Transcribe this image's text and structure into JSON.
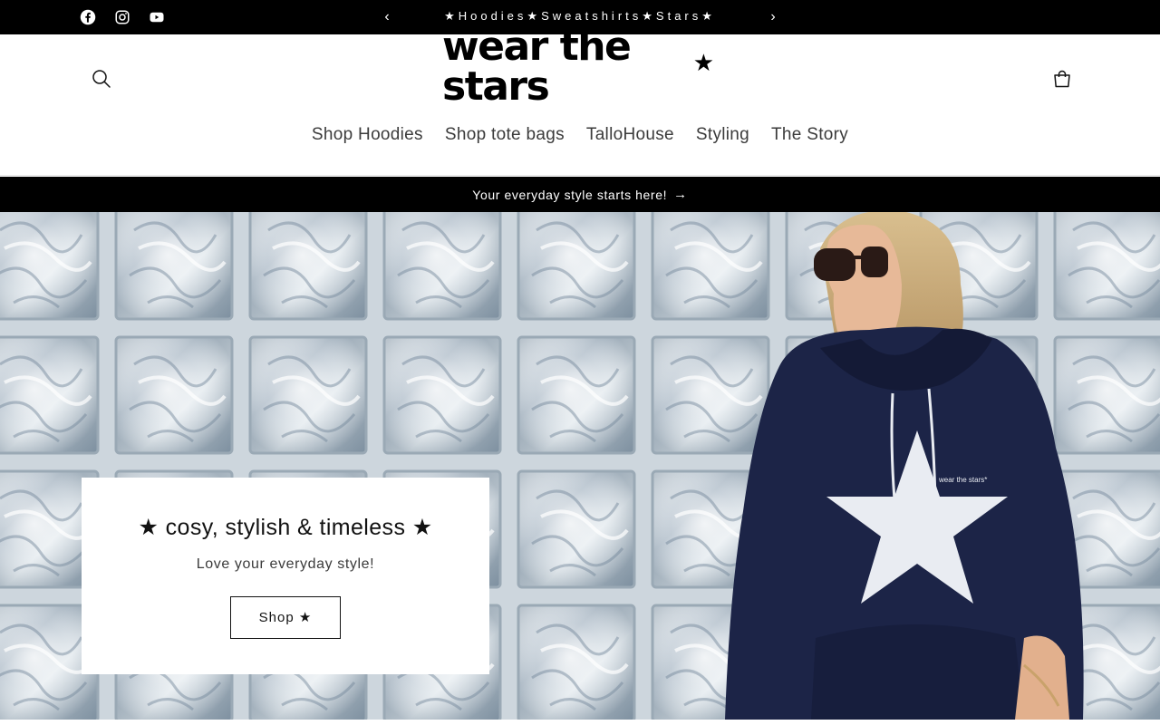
{
  "topbar": {
    "social": [
      {
        "icon": "facebook-icon"
      },
      {
        "icon": "instagram-icon"
      },
      {
        "icon": "youtube-icon"
      }
    ],
    "prev_arrow": "‹",
    "next_arrow": "›",
    "announcement": "★Hoodies★Sweatshirts★Stars★"
  },
  "header": {
    "logo_text": "wear the stars",
    "logo_star": "★",
    "nav": [
      {
        "label": "Shop Hoodies"
      },
      {
        "label": "Shop tote bags"
      },
      {
        "label": "TalloHouse"
      },
      {
        "label": "Styling"
      },
      {
        "label": "The Story"
      }
    ]
  },
  "promo": {
    "text": "Your everyday style starts here!",
    "arrow": "→"
  },
  "hero": {
    "headline": "★ cosy, stylish & timeless ★",
    "subtext": "Love your everyday style!",
    "button_label": "Shop ★",
    "hoodie_print": "wear the stars*"
  },
  "colors": {
    "bar_bg": "#000000",
    "text": "#121212",
    "nav_text": "#3b3b3b",
    "hoodie_navy": "#1c2447"
  }
}
